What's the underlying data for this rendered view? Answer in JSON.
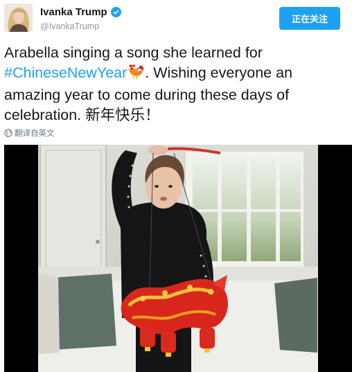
{
  "user": {
    "display_name": "Ivanka Trump",
    "handle": "@IvankaTrump",
    "verified": true
  },
  "follow_button": {
    "label": "正在关注"
  },
  "tweet": {
    "text_line1": "Arabella singing a song she learned for",
    "hashtag": "#ChineseNewYear",
    "text_after_hashtag": ". Wishing everyone an amazing year to come during these days of celebration. 新年快乐！"
  },
  "translate": {
    "icon": "globe-icon",
    "label": "翻译自英文"
  },
  "media": {
    "type": "video",
    "description_icon": "rooster-emoji"
  },
  "colors": {
    "accent": "#1da1f2",
    "text": "#14171a",
    "muted": "#8899a6"
  }
}
